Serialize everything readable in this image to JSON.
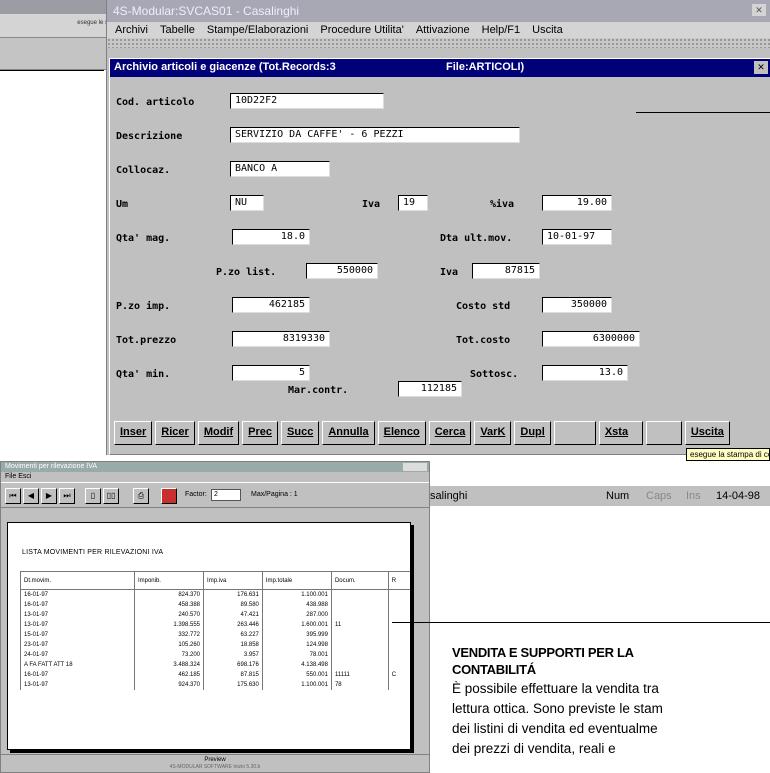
{
  "background_window": {
    "toolbar_text": "esegue le stam"
  },
  "app": {
    "title": "4S-Modular:SVCAS01 - Casalinghi",
    "menu": [
      "Archivi",
      "Tabelle",
      "Stampe/Elaborazioni",
      "Procedure Utilita'",
      "Attivazione",
      "Help/F1",
      "Uscita"
    ]
  },
  "form": {
    "title": "Archivio articoli e giacenze (Tot.Records:3",
    "file": "File:ARTICOLI)",
    "labels": {
      "cod_articolo": "Cod. articolo",
      "descrizione": "Descrizione",
      "collocaz": "Collocaz.",
      "um": "Um",
      "iva": "Iva",
      "piva": "%iva",
      "qta_mag": "Qta' mag.",
      "dta_ult_mov": "Dta ult.mov.",
      "p_list": "P.zo list.",
      "iva2": "Iva",
      "p_imp": "P.zo imp.",
      "costo_std": "Costo std",
      "tot_prezzo": "Tot.prezzo",
      "tot_costo": "Tot.costo",
      "qta_min": "Qta' min.",
      "sottosc": "Sottosc.",
      "mar_contr": "Mar.contr."
    },
    "values": {
      "cod_articolo": "10D22F2",
      "descrizione": "SERVIZIO DA CAFFE' - 6 PEZZI",
      "collocaz": "BANCO A",
      "um": "NU",
      "iva": "19",
      "piva": "19.00",
      "qta_mag": "18.0",
      "dta_ult_mov": "10-01-97",
      "p_list": "550000",
      "iva2": "87815",
      "p_imp": "462185",
      "costo_std": "350000",
      "tot_prezzo": "8319330",
      "tot_costo": "6300000",
      "qta_min": "5",
      "sottosc": "13.0",
      "mar_contr": "112185"
    },
    "buttons": [
      "Inser",
      "Ricer",
      "Modif",
      "Prec",
      "Succ",
      "Annulla",
      "Elenco",
      "Cerca",
      "VarK",
      "Dupl",
      "",
      "Xsta",
      "",
      "Uscita"
    ],
    "tooltip": "esegue la stampa di controllo dei dati inseriti"
  },
  "statusbar": {
    "left": "Casalinghi",
    "num": "Num",
    "caps": "Caps",
    "ins": "Ins",
    "date": "14-04-98"
  },
  "report": {
    "window_title": "Movimenti per rilevazione IVA",
    "menu": "File  Esci",
    "factor_label": "Factor:",
    "factor_value": "2",
    "page_label": "Max/Pagina : 1",
    "heading": "LISTA MOVIMENTI PER RILEVAZIONI IVA",
    "columns": [
      "Dt.movim.",
      "Imponib.",
      "Imp.iva",
      "Imp.totale",
      "Docum.",
      "R"
    ],
    "rows": [
      [
        "16-01-97",
        "824.370",
        "176.631",
        "1.100.001",
        "",
        ""
      ],
      [
        "16-01-97",
        "458.388",
        "89.580",
        "438.988",
        "",
        ""
      ],
      [
        "13-01-97",
        "240.570",
        "47.421",
        "287.000",
        "",
        ""
      ],
      [
        "13-01-97",
        "1.398.555",
        "263.446",
        "1.600.001",
        "11",
        ""
      ],
      [
        "15-01-97",
        "332.772",
        "63.227",
        "395.999",
        "",
        ""
      ],
      [
        "23-01-97",
        "105.260",
        "18.858",
        "124.998",
        "",
        ""
      ],
      [
        "24-01-97",
        "73.200",
        "3.957",
        "78.001",
        "",
        ""
      ],
      [
        "A FA FATT ATT  18",
        "3.488.324",
        "698.176",
        "4.138.498",
        "",
        ""
      ],
      [
        "16-01-97",
        "462.185",
        "87.815",
        "550.001",
        "11111",
        "C"
      ],
      [
        "13-01-97",
        "924.370",
        "175.630",
        "1.100.001",
        "78",
        ""
      ]
    ],
    "footer": "Preview",
    "status": "4S-MODULAR SOFTWARE   Inizio 5.30.b"
  },
  "caption": {
    "heading_line1": "VENDITA E SUPPORTI PER LA",
    "heading_line2": "CONTABILITÁ",
    "line1": "È possibile effettuare la vendita tra",
    "line2": "lettura ottica. Sono previste le stam",
    "line3": "dei listini di vendita ed eventualme",
    "line4": "dei prezzi di vendita, reali e"
  }
}
